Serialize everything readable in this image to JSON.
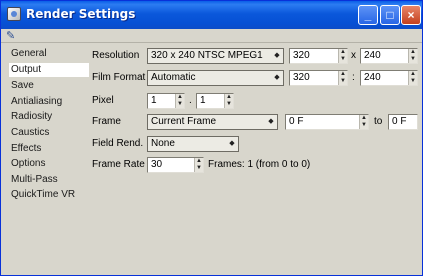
{
  "window": {
    "title": "Render Settings"
  },
  "controls": {
    "minimize": "_",
    "maximize": "□",
    "close": "×"
  },
  "icons": {
    "window": "app-icon",
    "tool": "wrench-icon"
  },
  "sidebar": {
    "items": [
      {
        "label": "General"
      },
      {
        "label": "Output"
      },
      {
        "label": "Save"
      },
      {
        "label": "Antialiasing"
      },
      {
        "label": "Radiosity"
      },
      {
        "label": "Caustics"
      },
      {
        "label": "Effects"
      },
      {
        "label": "Options"
      },
      {
        "label": "Multi-Pass"
      },
      {
        "label": "QuickTime VR"
      }
    ],
    "selected": "Output"
  },
  "output": {
    "resolution": {
      "label": "Resolution",
      "preset": "320 x 240 NTSC MPEG1",
      "width": "320",
      "sep": "x",
      "height": "240"
    },
    "film_format": {
      "label": "Film Format",
      "value": "Automatic",
      "width": "320",
      "sep": ":",
      "height": "240"
    },
    "pixel": {
      "label": "Pixel",
      "x": "1",
      "sep": ".",
      "y": "1"
    },
    "frame": {
      "label": "Frame",
      "value": "Current Frame",
      "from": "0 F",
      "to_label": "to",
      "to": "0 F"
    },
    "field_rend": {
      "label": "Field Rend.",
      "value": "None"
    },
    "frame_rate": {
      "label": "Frame Rate",
      "value": "30",
      "frames_text": "Frames: 1 (from 0 to 0)"
    }
  }
}
